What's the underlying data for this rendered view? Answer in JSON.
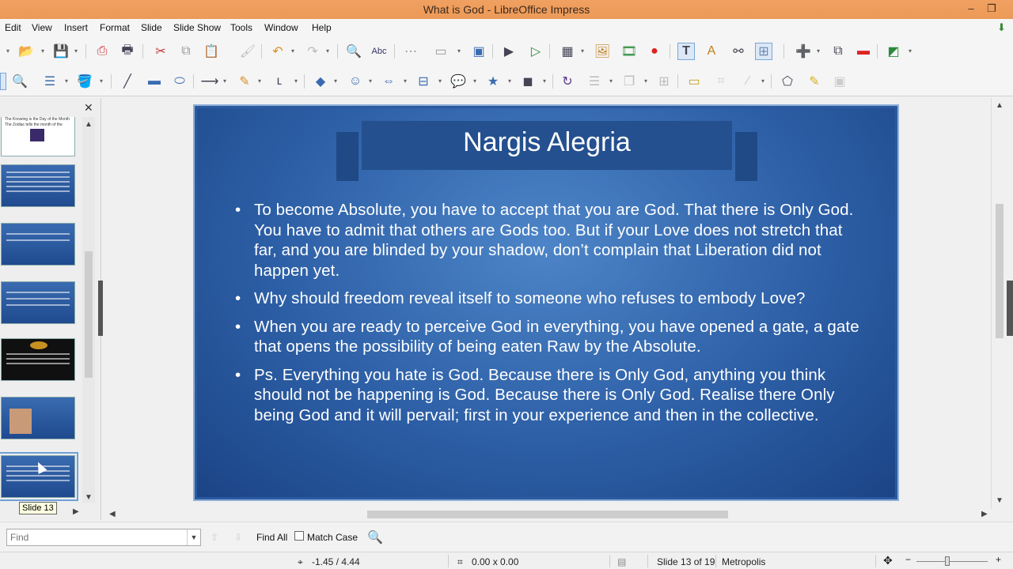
{
  "window": {
    "title": "What is God - LibreOffice Impress"
  },
  "menu": [
    "Edit",
    "View",
    "Insert",
    "Format",
    "Slide",
    "Slide Show",
    "Tools",
    "Window",
    "Help"
  ],
  "slide": {
    "title": "Nargis Alegria",
    "bullets": [
      "To become Absolute, you have to accept that you are God. That there is Only God. You have to admit that others are Gods too. But if your Love does not stretch that far, and you are blinded by your shadow, don’t complain that Liberation did not happen yet.",
      "Why should freedom reveal itself to someone who refuses to embody Love?",
      "When you are ready to perceive God in everything, you have opened a gate, a gate that opens the possibility of being eaten Raw by the Absolute.",
      "Ps. Everything you hate is God. Because there is Only God, anything you think should not be happening is God. Because there is Only God. Realise there Only being God and it will pervail; first in your experience and then in the collective."
    ]
  },
  "slide_pane": {
    "thumb1_text_a": "The Knowing is the Day of the Month",
    "thumb1_text_b": "The Zodiac tells the month of the",
    "tooltip": "Slide 13"
  },
  "findbar": {
    "placeholder": "Find",
    "find_all": "Find All",
    "match_case": "Match Case"
  },
  "status": {
    "position": "-1.45 / 4.44",
    "size": "0.00 x 0.00",
    "slide_info": "Slide 13 of 19",
    "master": "Metropolis"
  }
}
